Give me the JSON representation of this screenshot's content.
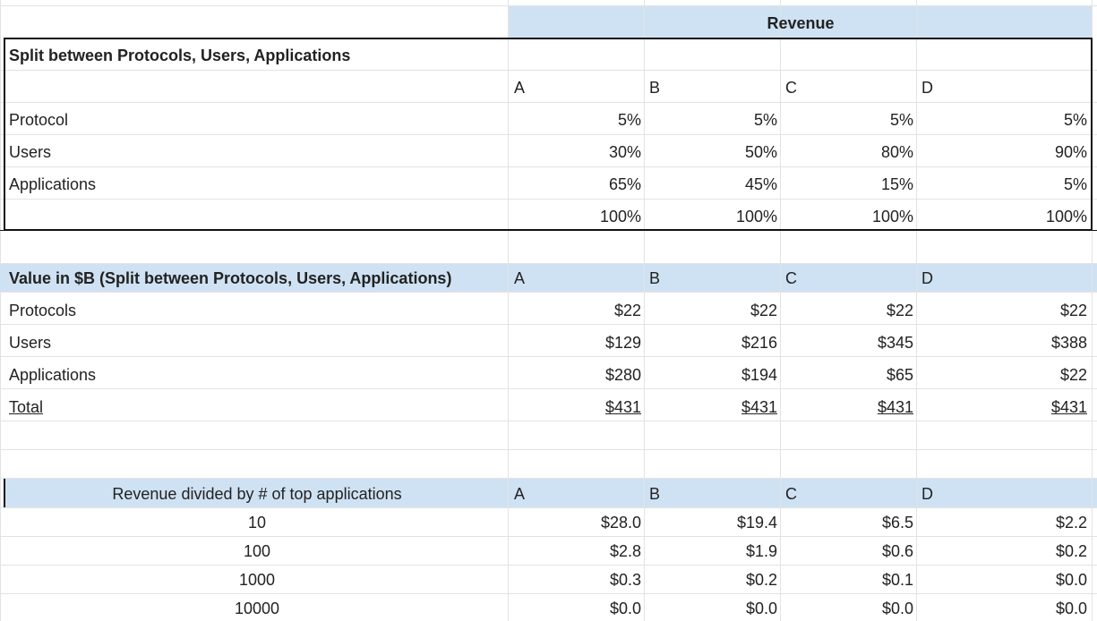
{
  "revenue_header": "Revenue",
  "split_section": {
    "title": "Split between Protocols, Users, Applications",
    "columns": [
      "A",
      "B",
      "C",
      "D"
    ],
    "rows": [
      {
        "label": "Protocol",
        "values": [
          "5%",
          "5%",
          "5%",
          "5%"
        ]
      },
      {
        "label": "Users",
        "values": [
          "30%",
          "50%",
          "80%",
          "90%"
        ]
      },
      {
        "label": "Applications",
        "values": [
          "65%",
          "45%",
          "15%",
          "5%"
        ]
      },
      {
        "label": "",
        "values": [
          "100%",
          "100%",
          "100%",
          "100%"
        ]
      }
    ]
  },
  "value_section": {
    "title": "Value in $B (Split between Protocols, Users, Applications)",
    "columns": [
      "A",
      "B",
      "C",
      "D"
    ],
    "rows": [
      {
        "label": "Protocols",
        "values": [
          "$22",
          "$22",
          "$22",
          "$22"
        ]
      },
      {
        "label": "Users",
        "values": [
          "$129",
          "$216",
          "$345",
          "$388"
        ]
      },
      {
        "label": "Applications",
        "values": [
          "$280",
          "$194",
          "$65",
          "$22"
        ]
      },
      {
        "label": "Total",
        "values": [
          "$431",
          "$431",
          "$431",
          "$431"
        ]
      }
    ]
  },
  "divided_section": {
    "title": "Revenue divided by # of  top applications",
    "columns": [
      "A",
      "B",
      "C",
      "D"
    ],
    "rows": [
      {
        "label": "10",
        "values": [
          "$28.0",
          "$19.4",
          "$6.5",
          "$2.2"
        ]
      },
      {
        "label": "100",
        "values": [
          "$2.8",
          "$1.9",
          "$0.6",
          "$0.2"
        ]
      },
      {
        "label": "1000",
        "values": [
          "$0.3",
          "$0.2",
          "$0.1",
          "$0.0"
        ]
      },
      {
        "label": "10000",
        "values": [
          "$0.0",
          "$0.0",
          "$0.0",
          "$0.0"
        ]
      }
    ]
  },
  "colors": {
    "header_fill": "#cfe2f3",
    "gridline": "#e2e3e3",
    "border": "#111111"
  }
}
